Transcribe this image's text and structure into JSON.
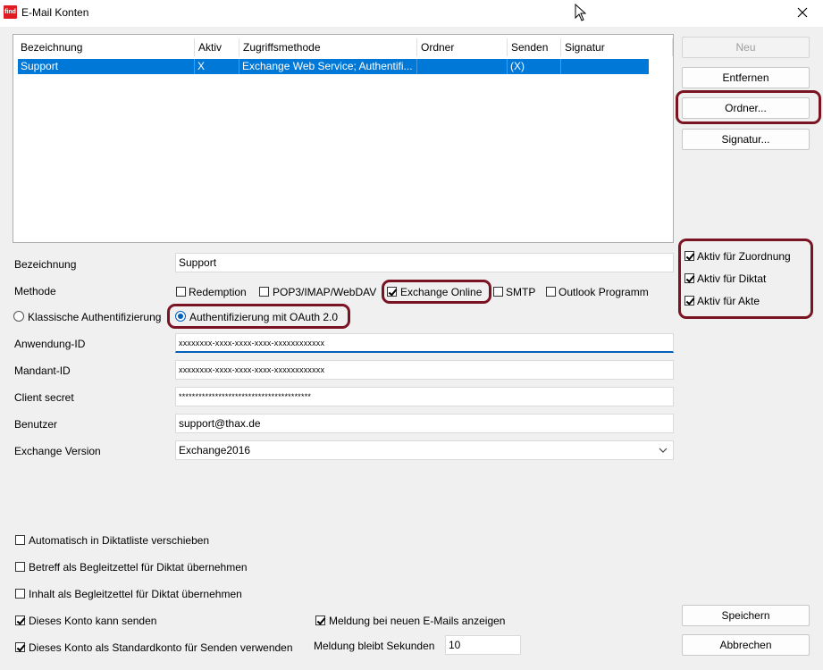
{
  "window": {
    "title": "E-Mail Konten",
    "icon_text": "find",
    "icon_name": "app-find-icon"
  },
  "list": {
    "columns": [
      "Bezeichnung",
      "Aktiv",
      "Zugriffsmethode",
      "Ordner",
      "Senden",
      "Signatur"
    ],
    "rows": [
      {
        "bezeichnung": "Support",
        "aktiv": "X",
        "zugriffsmethode": "Exchange Web Service; Authentifi...",
        "ordner": "",
        "senden": "(X)",
        "signatur": ""
      }
    ]
  },
  "buttons": {
    "neu": "Neu",
    "entfernen": "Entfernen",
    "ordner": "Ordner...",
    "signatur": "Signatur...",
    "speichern": "Speichern",
    "abbrechen": "Abbrechen"
  },
  "flags": [
    {
      "label": "Aktiv für Zuordnung",
      "checked": true
    },
    {
      "label": "Aktiv für Diktat",
      "checked": true
    },
    {
      "label": "Aktiv für Akte",
      "checked": true
    }
  ],
  "form": {
    "bezeichnung": {
      "label": "Bezeichnung",
      "value": "Support"
    },
    "methode": {
      "label": "Methode",
      "options": [
        {
          "label": "Redemption",
          "checked": false
        },
        {
          "label": "POP3/IMAP/WebDAV",
          "checked": false
        },
        {
          "label": "Exchange Online",
          "checked": true
        },
        {
          "label": "SMTP",
          "checked": false
        },
        {
          "label": "Outlook Programm",
          "checked": false
        }
      ]
    },
    "auth": {
      "classic": {
        "label": "Klassische Authentifizierung",
        "selected": false
      },
      "oauth": {
        "label": "Authentifizierung mit OAuth 2.0",
        "selected": true
      }
    },
    "anwendung_id": {
      "label": "Anwendung-ID",
      "value": "xxxxxxxx-xxxx-xxxx-xxxx-xxxxxxxxxxxx"
    },
    "mandant_id": {
      "label": "Mandant-ID",
      "value": "xxxxxxxx-xxxx-xxxx-xxxx-xxxxxxxxxxxx"
    },
    "client_secret": {
      "label": "Client secret",
      "value": "****************************************"
    },
    "benutzer": {
      "label": "Benutzer",
      "value": "support@thax.de"
    },
    "exchange_version": {
      "label": "Exchange Version",
      "value": "Exchange2016"
    }
  },
  "options": [
    {
      "label": "Automatisch in Diktatliste verschieben",
      "checked": false
    },
    {
      "label": "Betreff als Begleitzettel für Diktat übernehmen",
      "checked": false
    },
    {
      "label": "Inhalt als Begleitzettel für Diktat übernehmen",
      "checked": false
    },
    {
      "label": "Dieses Konto kann senden",
      "checked": true
    },
    {
      "label": "Dieses Konto als Standardkonto für Senden verwenden",
      "checked": true
    }
  ],
  "notify": {
    "label": "Meldung bei neuen E-Mails anzeigen",
    "checked": true,
    "seconds_label": "Meldung bleibt Sekunden",
    "seconds_value": "10"
  },
  "colors": {
    "selection": "#0078d7",
    "annotation": "#7a1423",
    "focus": "#005fb8"
  }
}
